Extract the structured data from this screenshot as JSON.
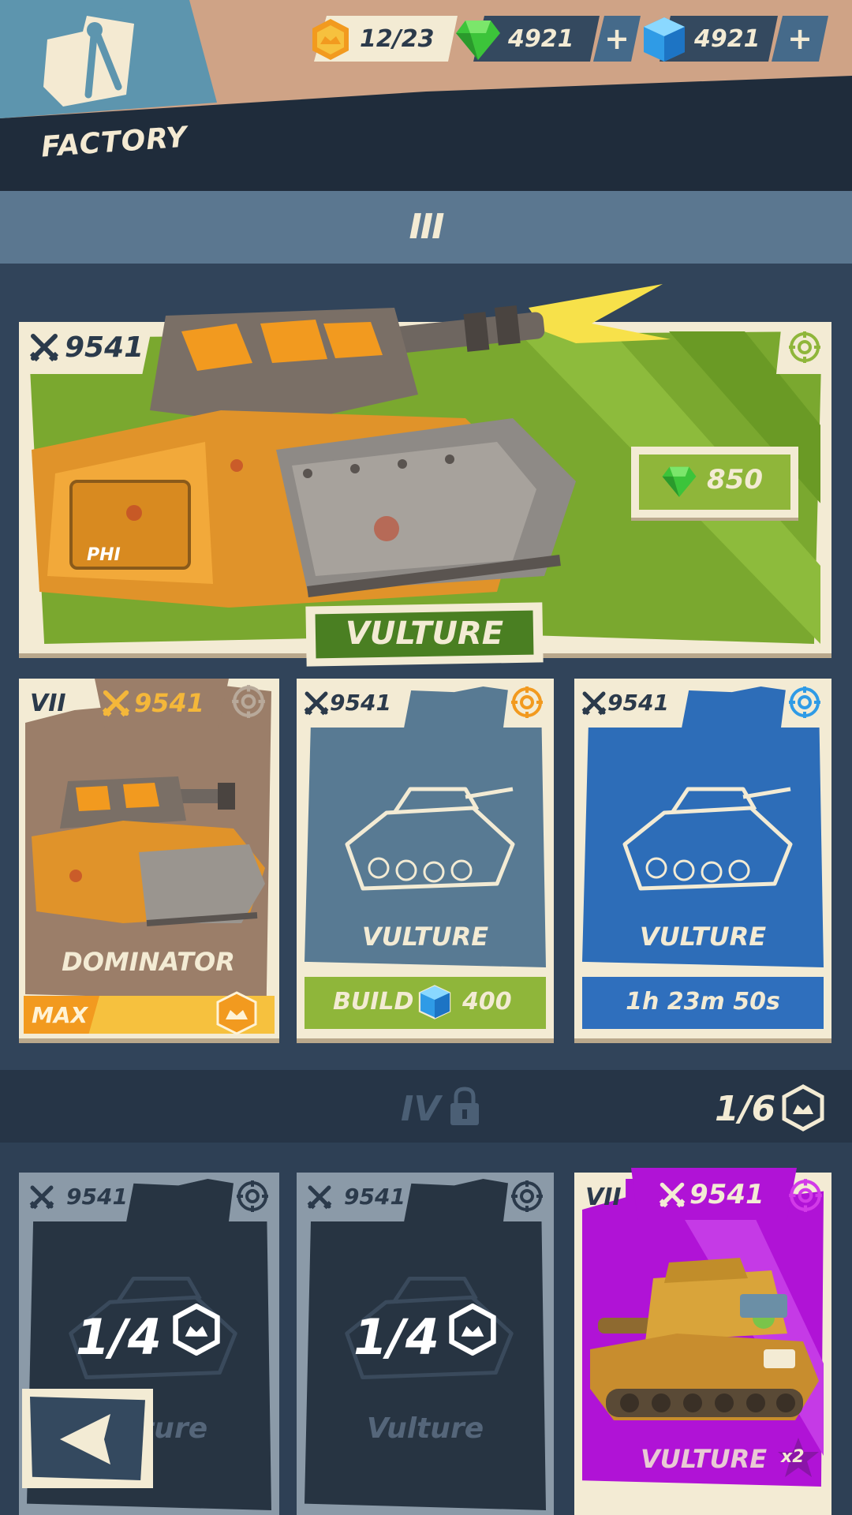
{
  "header": {
    "title": "FACTORY",
    "rank_progress": "12/23",
    "gems": "4921",
    "cubes": "4921",
    "plus_label": "+"
  },
  "tier3": {
    "label": "III",
    "featured": {
      "power": "9541",
      "price": "850",
      "name": "VULTURE"
    },
    "cards": [
      {
        "tier": "VII",
        "power": "9541",
        "name": "DOMINATOR",
        "status": "MAX"
      },
      {
        "power": "9541",
        "name": "VULTURE",
        "build_label": "BUILD",
        "build_cost": "400"
      },
      {
        "power": "9541",
        "name": "VULTURE",
        "timer": "1h 23m 50s"
      }
    ]
  },
  "tier4": {
    "label": "IV",
    "progress": "1/6",
    "cards": [
      {
        "power": "9541",
        "count": "1/4",
        "name": "Vulture"
      },
      {
        "power": "9541",
        "count": "1/4",
        "name": "Vulture"
      },
      {
        "tier": "VII",
        "power": "9541",
        "name": "VULTURE",
        "multiplier": "x2"
      }
    ]
  },
  "colors": {
    "cream": "#f3ebd4",
    "green": "#8fb63a",
    "blue": "#2f6fbd",
    "purple": "#b013d6",
    "gold": "#f4b73a"
  },
  "icons": {
    "factory": "compass-wrench-icon",
    "rank": "rank-chevron-icon",
    "gem": "green-gem-icon",
    "cube": "blue-cube-icon",
    "power": "crossed-swords-icon",
    "module": "gear-target-icon",
    "lock": "padlock-icon",
    "back": "back-arrow-icon"
  }
}
